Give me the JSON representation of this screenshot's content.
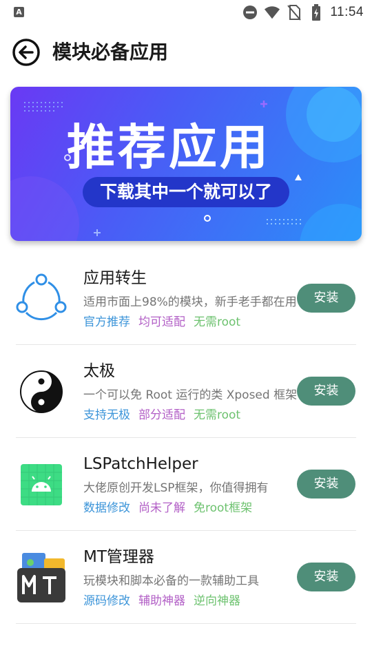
{
  "status_bar": {
    "time": "11:54",
    "left_icon": "A",
    "icons": [
      "do-not-disturb-icon",
      "wifi-icon",
      "no-sim-icon",
      "battery-charging-icon"
    ]
  },
  "header": {
    "title": "模块必备应用",
    "back_icon": "back-arrow-circle-icon"
  },
  "banner": {
    "title": "推荐应用",
    "subtitle": "下载其中一个就可以了"
  },
  "apps": [
    {
      "name": "应用转生",
      "description": "适用市面上98%的模块，新手老手都在用",
      "tags": [
        "官方推荐",
        "均可适配",
        "无需root"
      ],
      "button": "安装",
      "icon": "three-dots-ring-icon"
    },
    {
      "name": "太极",
      "description": "一个可以免 Root 运行的类 Xposed 框架",
      "tags": [
        "支持无极",
        "部分适配",
        "无需root"
      ],
      "button": "安装",
      "icon": "yin-yang-icon"
    },
    {
      "name": "LSPatchHelper",
      "description": "大佬原创开发LSP框架，你值得拥有",
      "tags": [
        "数据修改",
        "尚未了解",
        "免root框架"
      ],
      "button": "安装",
      "icon": "android-robot-icon"
    },
    {
      "name": "MT管理器",
      "description": "玩模块和脚本必备的一款辅助工具",
      "tags": [
        "源码修改",
        "辅助神器",
        "逆向神器"
      ],
      "button": "安装",
      "icon": "mt-manager-icon"
    }
  ],
  "colors": {
    "accent_button": "#4f8e79",
    "tag_blue": "#3d95d9",
    "tag_purple": "#b25fc6",
    "tag_green": "#6dc26f"
  }
}
